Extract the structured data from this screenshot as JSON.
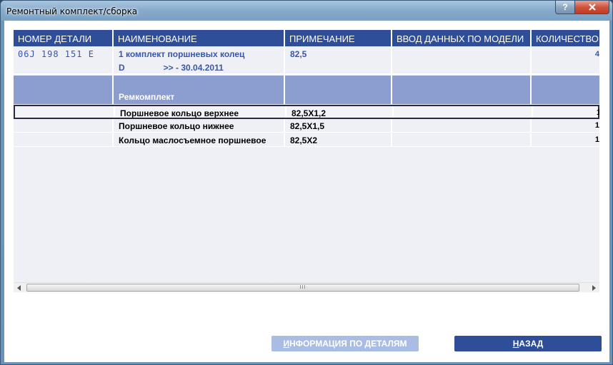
{
  "window": {
    "title": "Ремонтный комплект/сборка",
    "help_label": "?"
  },
  "table": {
    "columns": [
      "НОМЕР ДЕТАЛИ",
      "НАИМЕНОВАНИЕ",
      "ПРИМЕЧАНИЕ",
      "ВВОД ДАННЫХ ПО МОДЕЛИ",
      "КОЛИЧЕСТВО"
    ],
    "main_row": {
      "part_number": "06J 198 151 E",
      "name": "1 комплект поршневых колец",
      "variant": "D",
      "date_range": ">> - 30.04.2011",
      "note": "82,5",
      "quantity_partial": "4"
    },
    "group_row": {
      "name": "Ремкомплект"
    },
    "items": [
      {
        "name": "Поршневое кольцо верхнее",
        "note": "82,5X1,2",
        "quantity_partial": "1"
      },
      {
        "name": "Поршневое кольцо нижнее",
        "note": "82,5X1,5",
        "quantity_partial": "1"
      },
      {
        "name": "Кольцо маслосъемное поршневое",
        "note": "82,5X2",
        "quantity_partial": "1"
      }
    ]
  },
  "scrollbar": {
    "grip": "III"
  },
  "buttons": {
    "info_first": "И",
    "info_rest": "НФОРМАЦИЯ ПО ДЕТАЛЯМ",
    "back_first": "Н",
    "back_rest": "АЗАД"
  }
}
